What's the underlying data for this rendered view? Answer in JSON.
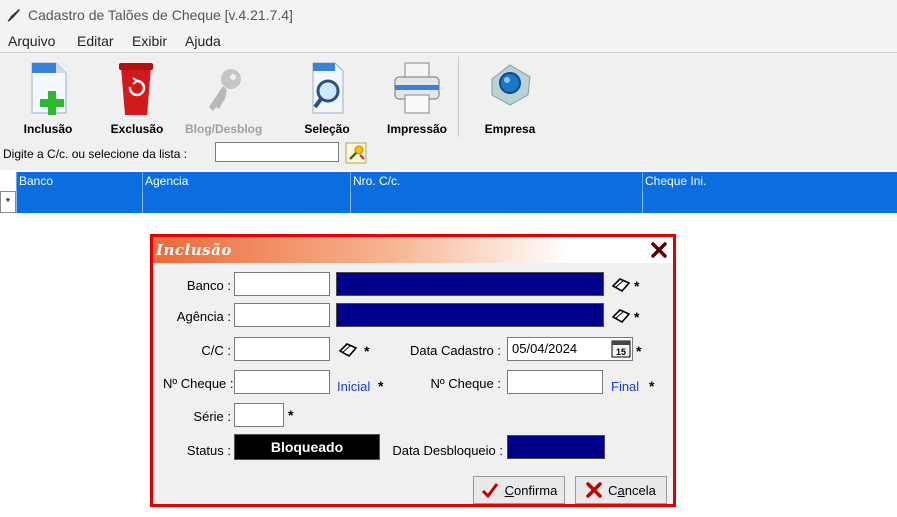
{
  "window": {
    "title": "Cadastro de Talões de Cheque [v.4.21.7.4]"
  },
  "menu": [
    "Arquivo",
    "Editar",
    "Exibir",
    "Ajuda"
  ],
  "toolbar": {
    "inclusao": "Inclusão",
    "exclusao": "Exclusão",
    "blog": "Blog/Desblog",
    "selecao": "Seleção",
    "impressao": "Impressão",
    "empresa": "Empresa"
  },
  "search": {
    "label": "Digite a C/c. ou selecione da lista :",
    "value": ""
  },
  "grid": {
    "columns": [
      "Banco",
      "Agencia",
      "Nro. C/c.",
      "Cheque Ini."
    ],
    "new_row_marker": "*"
  },
  "dialog": {
    "title": "Inclusão",
    "banco_label": "Banco :",
    "agencia_label": "Agência :",
    "cc_label": "C/C :",
    "data_cadastro_label": "Data Cadastro :",
    "data_cadastro_value": "05/04/2024",
    "calendar_day": "15",
    "cheque_ini_label": "Nº Cheque :",
    "inicial": "Inicial",
    "cheque_fim_label": "Nº Cheque :",
    "final": "Final",
    "serie_label": "Série :",
    "status_label": "Status :",
    "status_value": "Bloqueado",
    "data_desbloqueio_label": "Data Desbloqueio :",
    "required_mark": "*",
    "confirma_accel": "C",
    "confirma_rest": "onfirma",
    "cancela_pre": "C",
    "cancela_accel": "a",
    "cancela_rest": "ncela"
  },
  "colors": {
    "grid_blue": "#0a6de0",
    "navy": "#00008b",
    "dialog_border": "#e00000"
  }
}
